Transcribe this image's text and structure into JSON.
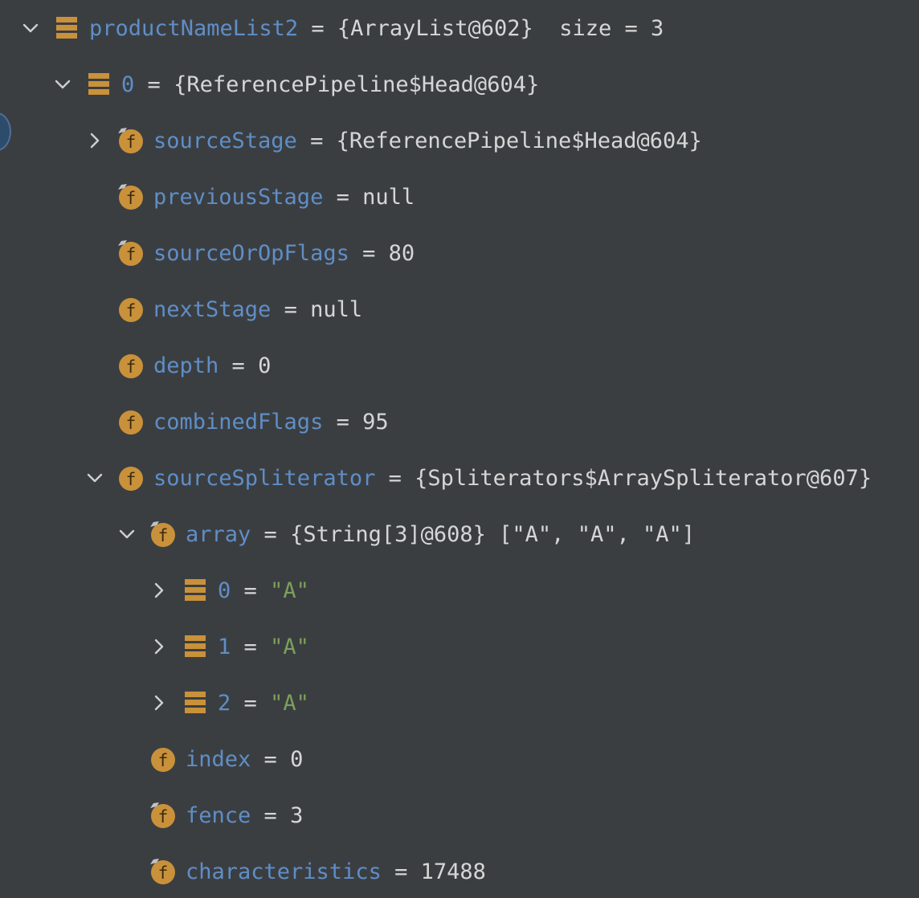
{
  "colors": {
    "background": "#3b3e41",
    "name": "#5f8ec7",
    "value": "#d6d6d6",
    "string": "#7ba05b",
    "icon_orange": "#c9913a",
    "chevron": "#cfcfcf"
  },
  "rows": [
    {
      "depth": 0,
      "toggle": "expanded",
      "icon": "array-list-icon",
      "name": "productNameList2",
      "op": "=",
      "value": "{ArrayList@602}",
      "extra": "  size = 3"
    },
    {
      "depth": 1,
      "toggle": "expanded",
      "icon": "array-list-icon",
      "name": "0",
      "op": "=",
      "value": "{ReferencePipeline$Head@604}"
    },
    {
      "depth": 2,
      "toggle": "collapsed",
      "icon": "final-field-icon",
      "name": "sourceStage",
      "op": "=",
      "value": "{ReferencePipeline$Head@604}"
    },
    {
      "depth": 2,
      "toggle": "none",
      "icon": "final-field-icon",
      "name": "previousStage",
      "op": "=",
      "value": "null"
    },
    {
      "depth": 2,
      "toggle": "none",
      "icon": "final-field-icon",
      "name": "sourceOrOpFlags",
      "op": "=",
      "value": "80"
    },
    {
      "depth": 2,
      "toggle": "none",
      "icon": "field-icon",
      "name": "nextStage",
      "op": "=",
      "value": "null"
    },
    {
      "depth": 2,
      "toggle": "none",
      "icon": "field-icon",
      "name": "depth",
      "op": "=",
      "value": "0"
    },
    {
      "depth": 2,
      "toggle": "none",
      "icon": "field-icon",
      "name": "combinedFlags",
      "op": "=",
      "value": "95"
    },
    {
      "depth": 2,
      "toggle": "expanded",
      "icon": "field-icon",
      "name": "sourceSpliterator",
      "op": "=",
      "value": "{Spliterators$ArraySpliterator@607}"
    },
    {
      "depth": 3,
      "toggle": "expanded",
      "icon": "final-field-icon",
      "name": "array",
      "op": "=",
      "value": "{String[3]@608} [\"A\", \"A\", \"A\"]"
    },
    {
      "depth": 4,
      "toggle": "collapsed",
      "icon": "array-list-icon",
      "name": "0",
      "op": "=",
      "value": "\"A\"",
      "is_string": true
    },
    {
      "depth": 4,
      "toggle": "collapsed",
      "icon": "array-list-icon",
      "name": "1",
      "op": "=",
      "value": "\"A\"",
      "is_string": true
    },
    {
      "depth": 4,
      "toggle": "collapsed",
      "icon": "array-list-icon",
      "name": "2",
      "op": "=",
      "value": "\"A\"",
      "is_string": true
    },
    {
      "depth": 3,
      "toggle": "none",
      "icon": "field-icon",
      "name": "index",
      "op": "=",
      "value": "0"
    },
    {
      "depth": 3,
      "toggle": "none",
      "icon": "final-field-icon",
      "name": "fence",
      "op": "=",
      "value": "3"
    },
    {
      "depth": 3,
      "toggle": "none",
      "icon": "final-field-icon",
      "name": "characteristics",
      "op": "=",
      "value": "17488"
    }
  ]
}
